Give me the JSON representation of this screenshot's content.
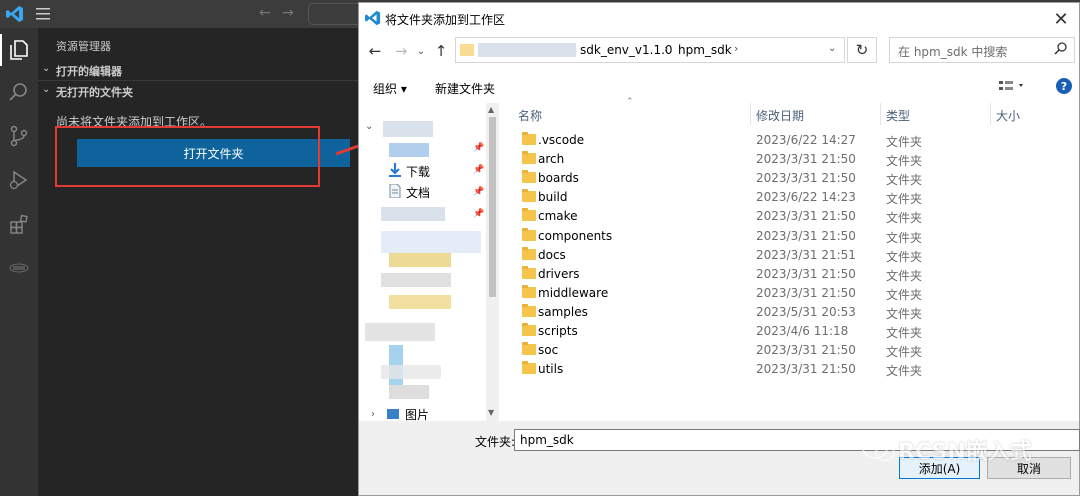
{
  "vscode": {
    "explorer_title": "资源管理器",
    "section_open_editors": "打开的编辑器",
    "section_no_folder": "无打开的文件夹",
    "no_folder_message": "尚未将文件夹添加到工作区。",
    "open_folder_button": "打开文件夹"
  },
  "dialog": {
    "title": "将文件夹添加到工作区",
    "close_label": "✕",
    "address_path": [
      "sdk_env_v1.1.0",
      "hpm_sdk"
    ],
    "search_placeholder": "在 hpm_sdk 中搜索",
    "toolbar": {
      "organize": "组织 ▾",
      "new_folder": "新建文件夹"
    },
    "nav_items": [
      {
        "label": "下载"
      },
      {
        "label": "文档"
      },
      {
        "label": "图片"
      }
    ],
    "columns": {
      "name": "名称",
      "date": "修改日期",
      "type": "类型",
      "size": "大小"
    },
    "files": [
      {
        "name": ".vscode",
        "date": "2023/6/22 14:27",
        "type": "文件夹"
      },
      {
        "name": "arch",
        "date": "2023/3/31 21:50",
        "type": "文件夹"
      },
      {
        "name": "boards",
        "date": "2023/3/31 21:50",
        "type": "文件夹"
      },
      {
        "name": "build",
        "date": "2023/6/22 14:23",
        "type": "文件夹"
      },
      {
        "name": "cmake",
        "date": "2023/3/31 21:50",
        "type": "文件夹"
      },
      {
        "name": "components",
        "date": "2023/3/31 21:50",
        "type": "文件夹"
      },
      {
        "name": "docs",
        "date": "2023/3/31 21:51",
        "type": "文件夹"
      },
      {
        "name": "drivers",
        "date": "2023/3/31 21:50",
        "type": "文件夹"
      },
      {
        "name": "middleware",
        "date": "2023/3/31 21:50",
        "type": "文件夹"
      },
      {
        "name": "samples",
        "date": "2023/5/31 20:53",
        "type": "文件夹"
      },
      {
        "name": "scripts",
        "date": "2023/4/6 11:18",
        "type": "文件夹"
      },
      {
        "name": "soc",
        "date": "2023/3/31 21:50",
        "type": "文件夹"
      },
      {
        "name": "utils",
        "date": "2023/3/31 21:50",
        "type": "文件夹"
      }
    ],
    "folder_label": "文件夹:",
    "folder_value": "hpm_sdk",
    "add_button": "添加(A)",
    "cancel_button": "取消"
  },
  "watermark": "RCSN嵌入式",
  "colors": {
    "vscode_blue": "#0e639c",
    "highlight_red": "#e53935",
    "folder_yellow": "#f5c44a"
  }
}
